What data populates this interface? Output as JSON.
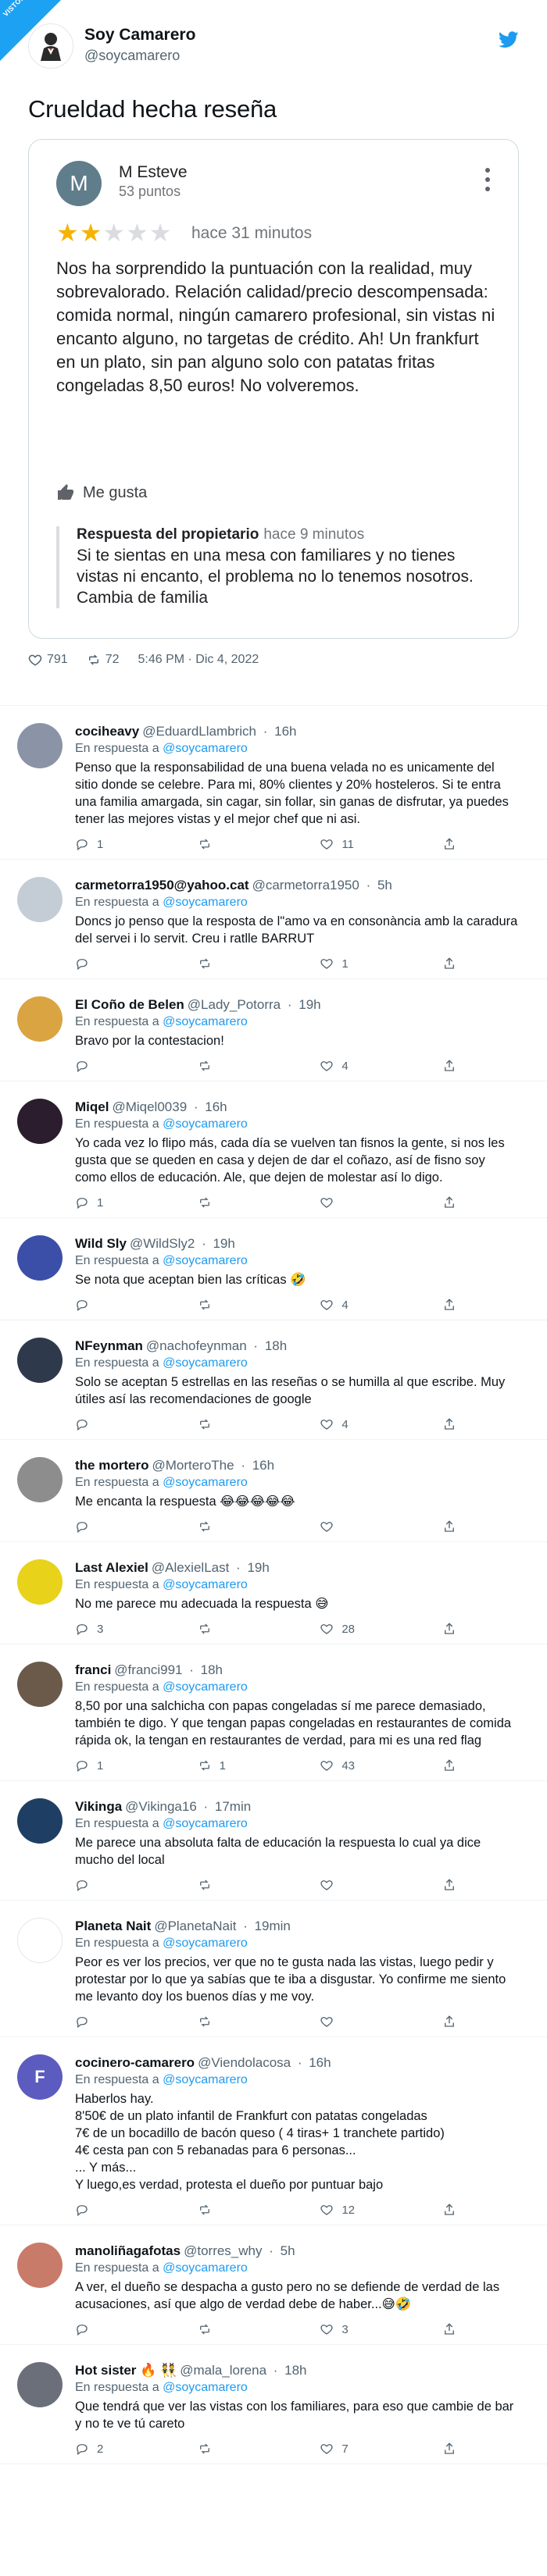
{
  "badge": "VISTOENLASREDES",
  "author": {
    "name": "Soy Camarero",
    "handle": "@soycamarero"
  },
  "tweet_text": "Crueldad hecha reseña",
  "review": {
    "avatar_letter": "M",
    "name": "M Esteve",
    "points": "53 puntos",
    "stars": 2,
    "time": "hace 31 minutos",
    "text": "Nos ha sorprendido la puntuación con la realidad, muy sobrevalorado. Relación calidad/precio descompensada: comida normal, ningún camarero profesional, sin vistas ni encanto alguno, no targetas de crédito. Ah! Un frankfurt en un plato, sin pan alguno solo con patatas fritas congeladas 8,50 euros! No volveremos.",
    "like_label": "Me gusta",
    "owner_label": "Respuesta del propietario",
    "owner_time": "hace 9 minutos",
    "owner_text": "Si te sientas en una mesa con familiares y no tienes vistas ni encanto, el problema no lo tenemos nosotros. Cambia de familia"
  },
  "stats": {
    "likes": "791",
    "retweets": "72",
    "time": "5:46 PM · Dic 4, 2022"
  },
  "reply_prefix": "En respuesta a",
  "replies": [
    {
      "name": "cociheavy",
      "handle": "@EduardLlambrich",
      "time": "16h",
      "text": "Penso que la responsabilidad de una buena velada no es unicamente del sitio donde se celebre. Para mi, 80% clientes y 20% hosteleros. Si te entra una familia amargada, sin cagar, sin follar, sin ganas de disfrutar, ya puedes tener las mejores vistas y el mejor chef que ni asi.",
      "replies": "1",
      "retweets": "",
      "likes": "11",
      "avatar_color": "#8a94a6",
      "avatar_text": ""
    },
    {
      "name": "carmetorra1950@yahoo.cat",
      "handle": "@carmetorra1950",
      "time": "5h",
      "text": "Doncs jo penso que la resposta de l\"amo va en consonància amb la caradura del servei i lo servit. Creu i ratlle BARRUT",
      "replies": "",
      "retweets": "",
      "likes": "1",
      "avatar_color": "#c4cdd6",
      "avatar_text": ""
    },
    {
      "name": "El Coño de Belen",
      "handle": "@Lady_Potorra",
      "time": "19h",
      "text": "Bravo por la contestacion!",
      "replies": "",
      "retweets": "",
      "likes": "4",
      "avatar_color": "#d9a441",
      "avatar_text": ""
    },
    {
      "name": "Miqel",
      "handle": "@Miqel0039",
      "time": "16h",
      "text": "Yo cada vez lo flipo más, cada día se vuelven tan fisnos la gente, si nos les gusta que se queden en casa y dejen de dar el coñazo, así de fisno soy como ellos de educación. Ale, que dejen de molestar así lo digo.",
      "replies": "1",
      "retweets": "",
      "likes": "",
      "avatar_color": "#2b1d2e",
      "avatar_text": ""
    },
    {
      "name": "Wild Sly",
      "handle": "@WildSly2",
      "time": "19h",
      "text": "Se nota que aceptan bien las críticas 🤣",
      "replies": "",
      "retweets": "",
      "likes": "4",
      "avatar_color": "#3b4fa8",
      "avatar_text": ""
    },
    {
      "name": "NFeynman",
      "handle": "@nachofeynman",
      "time": "18h",
      "text": "Solo se aceptan 5 estrellas en las reseñas o se humilla al que escribe. Muy útiles así las recomendaciones de google",
      "replies": "",
      "retweets": "",
      "likes": "4",
      "avatar_color": "#2e3a4c",
      "avatar_text": ""
    },
    {
      "name": "the mortero",
      "handle": "@MorteroThe",
      "time": "16h",
      "text": "Me encanta la respuesta 😂😂😂😂😂",
      "replies": "",
      "retweets": "",
      "likes": "",
      "avatar_color": "#8d8d8d",
      "avatar_text": ""
    },
    {
      "name": "Last Alexiel",
      "handle": "@AlexielLast",
      "time": "19h",
      "text": "No me parece mu adecuada la respuesta 😅",
      "replies": "3",
      "retweets": "",
      "likes": "28",
      "avatar_color": "#e8d21a",
      "avatar_text": ""
    },
    {
      "name": "franci",
      "handle": "@franci991",
      "time": "18h",
      "text": "8,50 por una salchicha con papas congeladas sí me parece demasiado, también te digo. Y que tengan papas congeladas en restaurantes de comida rápida ok, la tengan en restaurantes de verdad, para mi es una red flag",
      "replies": "1",
      "retweets": "1",
      "likes": "43",
      "avatar_color": "#6b5a4a",
      "avatar_text": ""
    },
    {
      "name": "Vikinga",
      "handle": "@Vikinga16",
      "time": "17min",
      "text": "Me parece una absoluta falta de educación la respuesta lo cual ya dice mucho del local",
      "replies": "",
      "retweets": "",
      "likes": "",
      "avatar_color": "#1f3e63",
      "avatar_text": ""
    },
    {
      "name": "Planeta Nait",
      "handle": "@PlanetaNait",
      "time": "19min",
      "text": "Peor es ver los precios, ver que no te gusta nada las vistas, luego pedir y protestar por lo que ya sabías que te iba a disgustar. Yo confirme me siento me levanto doy los buenos días y me voy.",
      "replies": "",
      "retweets": "",
      "likes": "",
      "avatar_color": "#ffffff",
      "avatar_text": ""
    },
    {
      "name": "cocinero-camarero",
      "handle": "@Viendolacosa",
      "time": "16h",
      "text": "Haberlos hay.\n8'50€ de un plato infantil de Frankfurt con patatas congeladas\n7€ de un bocadillo de bacón queso ( 4 tiras+ 1 tranchete partido)\n4€ cesta pan con 5 rebanadas para 6 personas...\n... Y más...\nY luego,es verdad, protesta el dueño por puntuar bajo",
      "replies": "",
      "retweets": "",
      "likes": "12",
      "avatar_color": "#5c5bbf",
      "avatar_text": "F"
    },
    {
      "name": "manoliñagafotas",
      "handle": "@torres_why",
      "time": "5h",
      "text": "A ver, el dueño se despacha a gusto pero no se defiende de verdad de las acusaciones, así que algo de verdad debe de haber...😅🤣",
      "replies": "",
      "retweets": "",
      "likes": "3",
      "avatar_color": "#c97b6a",
      "avatar_text": ""
    },
    {
      "name": "Hot sister 🔥 👯",
      "handle": "@mala_lorena",
      "time": "18h",
      "text": "Que tendrá que ver las vistas con los familiares, para eso que cambie de bar y no te ve tú careto",
      "replies": "2",
      "retweets": "",
      "likes": "7",
      "avatar_color": "#6b6f7a",
      "avatar_text": ""
    }
  ]
}
